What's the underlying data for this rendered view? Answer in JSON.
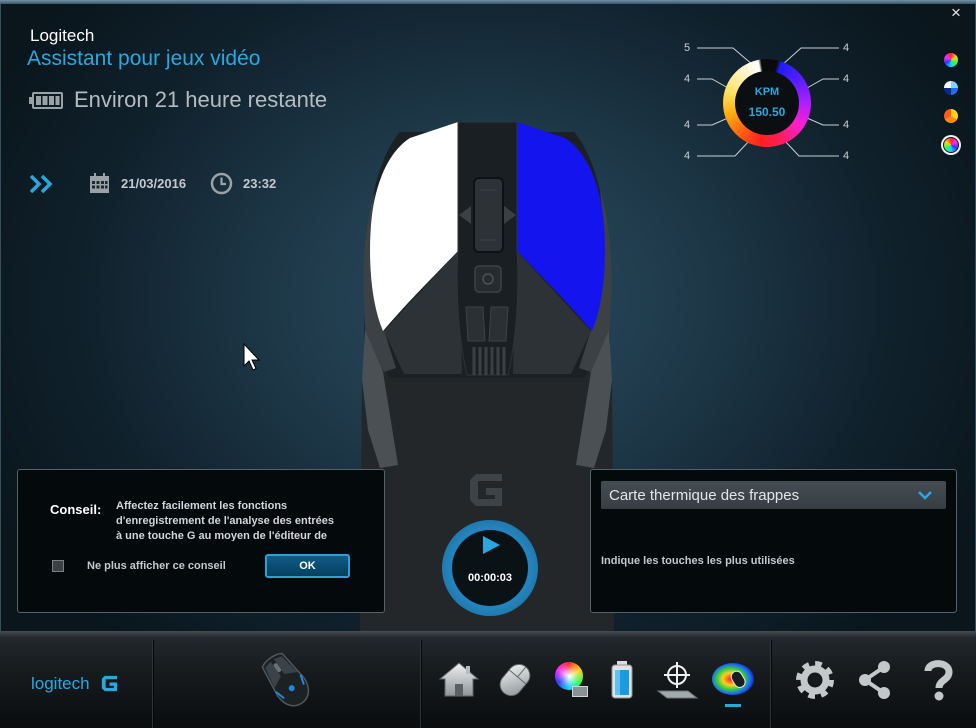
{
  "window": {
    "close_glyph": "×"
  },
  "header": {
    "brand": "Logitech",
    "title": "Assistant pour jeux vidéo",
    "battery_icon": "battery-icon",
    "battery_text": "Environ 21 heure restante"
  },
  "session": {
    "expand_icon": "double-chevron-right-icon",
    "date_icon": "calendar-icon",
    "date": "21/03/2016",
    "time_icon": "clock-icon",
    "time": "23:32"
  },
  "gauge": {
    "label": "KPM",
    "value": "150.50",
    "left_labels": [
      "5",
      "4",
      "4",
      "4"
    ],
    "right_labels": [
      "4",
      "4",
      "4",
      "4"
    ]
  },
  "color_modes": {
    "items": [
      "rainbow-icon",
      "blue-spectrum-icon",
      "orange-spectrum-icon",
      "full-spectrum-icon"
    ],
    "selected": 3
  },
  "mouse": {
    "left_button_color": "#ffffff",
    "right_button_color": "#1414ee"
  },
  "tip": {
    "label": "Conseil:",
    "lines": [
      "Affectez facilement les fonctions",
      "d'enregistrement de l'analyse des entrées",
      "à une touche G au moyen de l'éditeur de"
    ],
    "checkbox_label": "Ne plus afficher ce conseil",
    "checked": false,
    "ok_label": "OK"
  },
  "timer": {
    "play_icon": "play-icon",
    "elapsed": "00:00:03"
  },
  "view_panel": {
    "selected_view": "Carte thermique des frappes",
    "description": "Indique les touches les plus utilisées"
  },
  "footer": {
    "logo_text": "logitech",
    "nav": [
      "home-icon",
      "mouse-customize-icon",
      "lighting-icon",
      "battery-icon",
      "pointer-settings-icon",
      "heatmap-icon"
    ],
    "active": "heatmap-icon",
    "tools": [
      "gear-icon",
      "share-icon",
      "help-icon"
    ]
  },
  "colors": {
    "accent": "#29a8e0",
    "muted_text": "#b4bcc1",
    "timer_ring": "#2383bb",
    "panel_bg": "#04090c"
  }
}
